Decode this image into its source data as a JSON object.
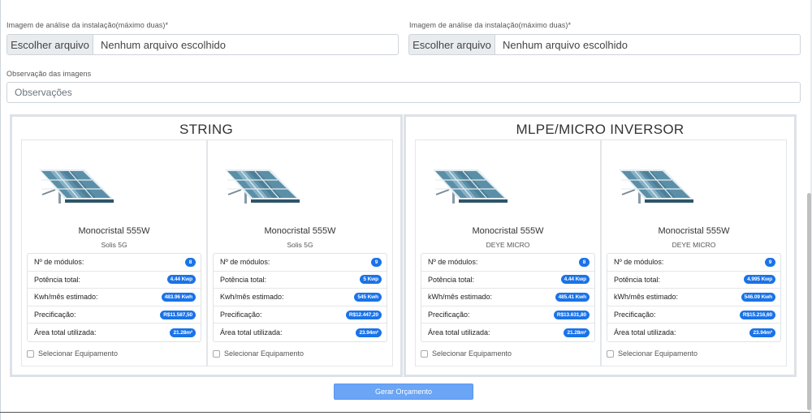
{
  "uploads": [
    {
      "label": "Imagem de análise da instalação(máximo duas)*",
      "button": "Escolher arquivo",
      "status": "Nenhum arquivo escolhido"
    },
    {
      "label": "Imagem de análise da instalação(máximo duas)*",
      "button": "Escolher arquivo",
      "status": "Nenhum arquivo escolhido"
    }
  ],
  "observations": {
    "label": "Observação das imagens",
    "placeholder": "Observações"
  },
  "groups": [
    {
      "title": "STRING",
      "cards": [
        {
          "title": "Monocristal 555W",
          "subtitle": "Solis 5G",
          "specs": [
            {
              "label": "Nº de módulos:",
              "value": "8"
            },
            {
              "label": "Potência total:",
              "value": "4.44 Kwp"
            },
            {
              "label": "Kwh/mês estimado:",
              "value": "483.96 Kwh"
            },
            {
              "label": "Precificação:",
              "value": "R$11.587,50"
            },
            {
              "label": "Área total utilizada:",
              "value": "21.28m²"
            }
          ],
          "select_label": "Selecionar Equipamento"
        },
        {
          "title": "Monocristal 555W",
          "subtitle": "Solis 5G",
          "specs": [
            {
              "label": "Nº de módulos:",
              "value": "9"
            },
            {
              "label": "Potência total:",
              "value": "5 Kwp"
            },
            {
              "label": "Kwh/mês estimado:",
              "value": "545 Kwh"
            },
            {
              "label": "Precificação:",
              "value": "R$12.447,20"
            },
            {
              "label": "Área total utilizada:",
              "value": "23.94m²"
            }
          ],
          "select_label": "Selecionar Equipamento"
        }
      ]
    },
    {
      "title": "MLPE/MICRO INVERSOR",
      "cards": [
        {
          "title": "Monocristal 555W",
          "subtitle": "DEYE MICRO",
          "specs": [
            {
              "label": "Nº de módulos:",
              "value": "8"
            },
            {
              "label": "Potência total:",
              "value": "4.44 Kwp"
            },
            {
              "label": "kWh/mês estimado:",
              "value": "485.41 Kwh"
            },
            {
              "label": "Precificação:",
              "value": "R$13.631,80"
            },
            {
              "label": "Área total utilizada:",
              "value": "21.28m²"
            }
          ],
          "select_label": "Selecionar Equipamento"
        },
        {
          "title": "Monocristal 555W",
          "subtitle": "DEYE MICRO",
          "specs": [
            {
              "label": "Nº de módulos:",
              "value": "9"
            },
            {
              "label": "Potência total:",
              "value": "4.995 Kwp"
            },
            {
              "label": "kWh/mês estimado:",
              "value": "546.09 Kwh"
            },
            {
              "label": "Precificação:",
              "value": "R$15.216,60"
            },
            {
              "label": "Área total utilizada:",
              "value": "23.94m²"
            }
          ],
          "select_label": "Selecionar Equipamento"
        }
      ]
    }
  ],
  "actions": {
    "generate": "Gerar Orçamento"
  },
  "colors": {
    "badge": "#1a73e8",
    "button": "#6aa5f6",
    "panel": "#5b8fa8"
  },
  "icons": {
    "panel": "solar-panel-icon"
  }
}
